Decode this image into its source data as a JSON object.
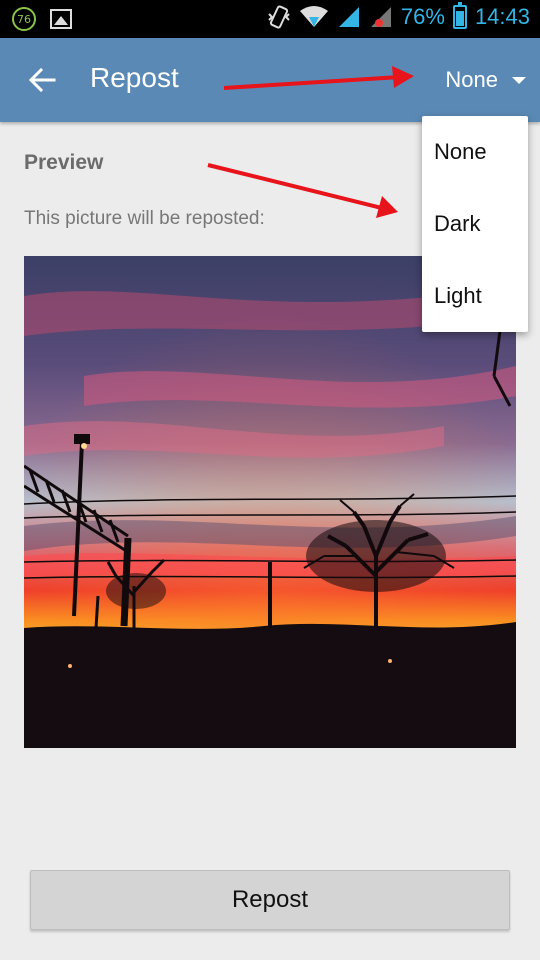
{
  "status_bar": {
    "notification_badge": "76",
    "battery_percent": "76%",
    "time": "14:43",
    "icons": [
      "notification-badge-icon",
      "gallery-icon",
      "vibrate-icon",
      "wifi-icon",
      "signal-icon",
      "signal-roaming-icon",
      "battery-icon"
    ],
    "accent_color": "#33b5e5"
  },
  "toolbar": {
    "title": "Repost",
    "back_icon": "arrow-left-icon",
    "filter_selected": "None",
    "background_color": "#5a89b5"
  },
  "dropdown": {
    "options": [
      "None",
      "Dark",
      "Light"
    ]
  },
  "preview": {
    "heading": "Preview",
    "description": "This picture will be reposted:",
    "image_subject": "sunset sky over silhouetted trees and railway power lines"
  },
  "actions": {
    "repost_label": "Repost"
  },
  "annotations": {
    "arrow_color": "#e8141b"
  }
}
